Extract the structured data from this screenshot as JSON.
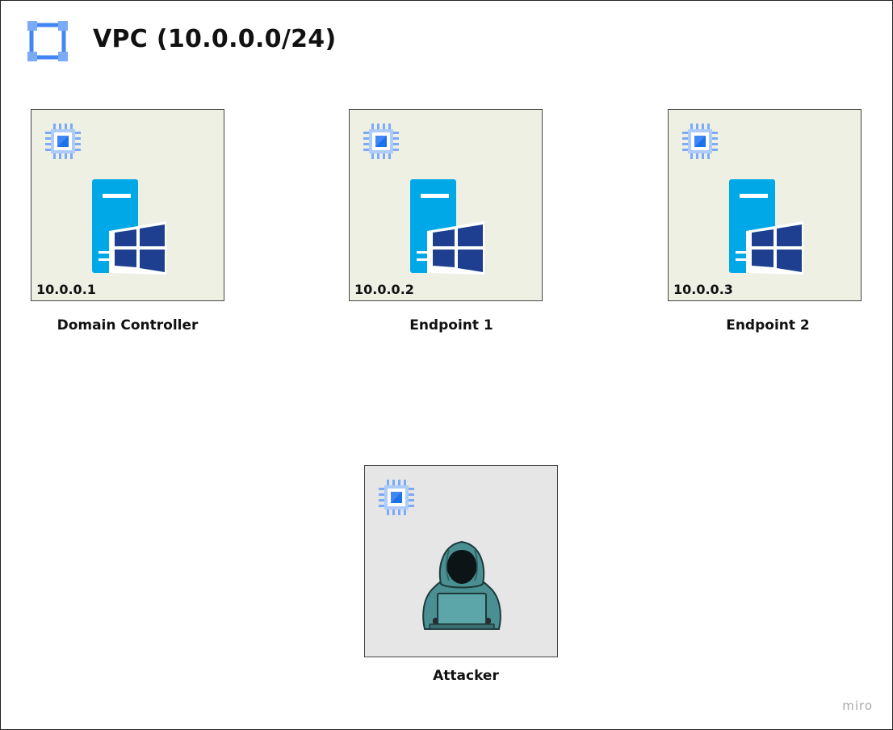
{
  "vpc": {
    "title": "VPC (10.0.0.0/24)",
    "icon": "vpc-bracket-icon"
  },
  "nodes": [
    {
      "name": "Domain Controller",
      "ip": "10.0.0.1",
      "icon": "windows-server-icon"
    },
    {
      "name": "Endpoint 1",
      "ip": "10.0.0.2",
      "icon": "windows-server-icon"
    },
    {
      "name": "Endpoint 2",
      "ip": "10.0.0.3",
      "icon": "windows-server-icon"
    },
    {
      "name": "Attacker",
      "ip": "",
      "icon": "hooded-hacker-icon"
    }
  ],
  "watermark": "miro",
  "colors": {
    "vpc_icon": "#4285f4",
    "vm_node_fill": "#eff0e4",
    "attacker_node_fill": "#e6e6e6",
    "server_body": "#00a8e8",
    "windows_logo": "#1e3f8f"
  }
}
